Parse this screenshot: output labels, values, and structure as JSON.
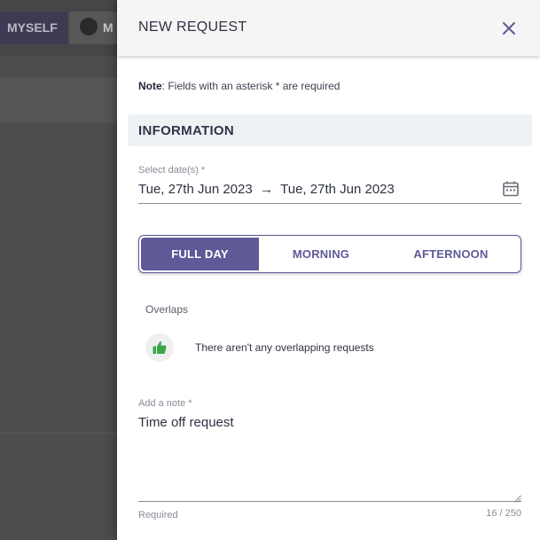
{
  "background": {
    "tabs": [
      {
        "label": "MYSELF"
      },
      {
        "label": "M"
      }
    ]
  },
  "drawer": {
    "title": "NEW REQUEST",
    "note_bold": "Note",
    "note_text": ": Fields with an asterisk * are required",
    "section_title": "INFORMATION",
    "date": {
      "label": "Select date(s) *",
      "start": "Tue, 27th Jun 2023",
      "arrow": "→",
      "end": "Tue, 27th Jun 2023"
    },
    "duration": {
      "options": [
        "FULL DAY",
        "MORNING",
        "AFTERNOON"
      ],
      "selected": "FULL DAY"
    },
    "overlaps": {
      "label": "Overlaps",
      "message": "There aren't any overlapping requests",
      "icon": "thumbs-up-icon"
    },
    "note_field": {
      "label": "Add a note *",
      "value": "Time off request",
      "helper": "Required",
      "counter": "16 / 250"
    }
  },
  "colors": {
    "accent": "#5e5a98",
    "success": "#3aa846",
    "overlay": "#4d4d4d"
  }
}
